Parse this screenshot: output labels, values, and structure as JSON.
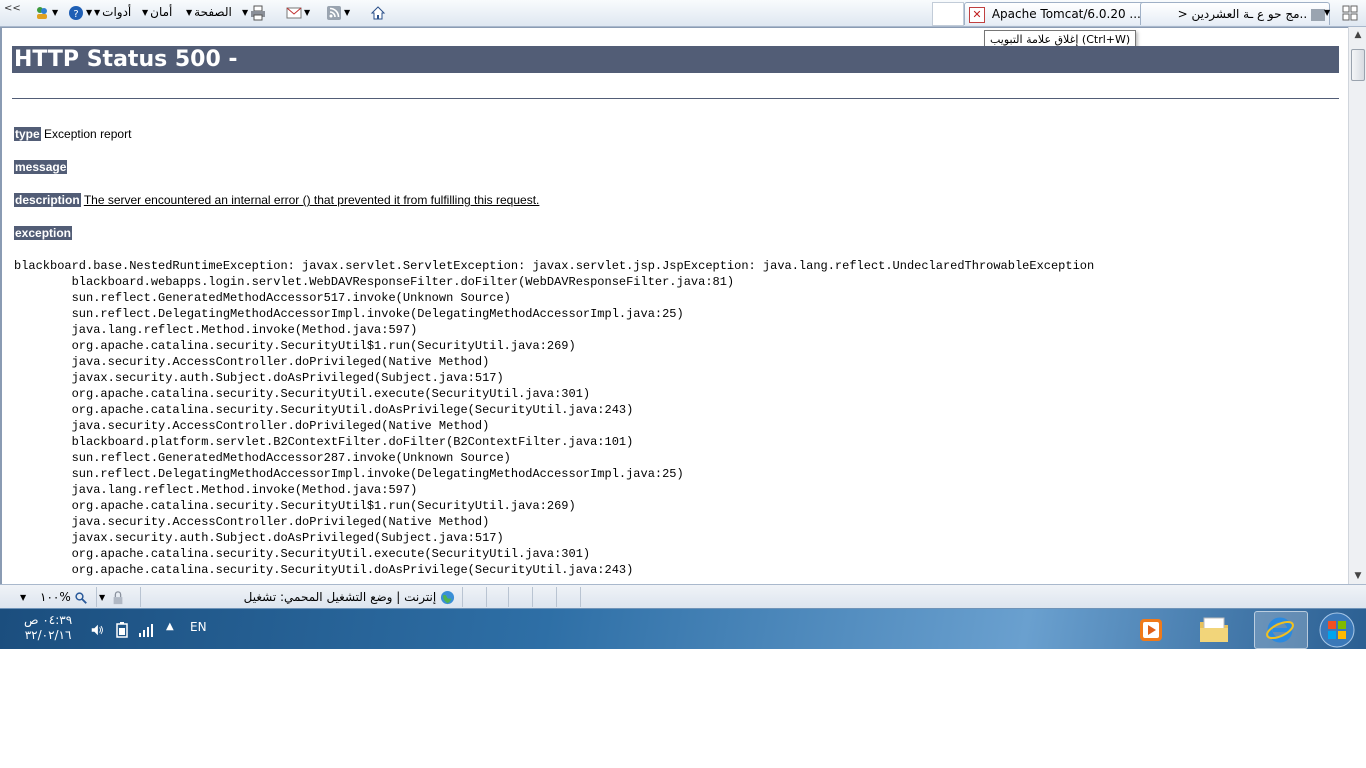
{
  "toolbar": {
    "tools_label": "أدوات",
    "safety_label": "أمان",
    "page_label": "الصفحة",
    "overflow_chevron": "<<"
  },
  "tabs": [
    {
      "title": "Apache Tomcat/6.0.20 ...",
      "close_glyph": "✕"
    },
    {
      "title": "..ﻣﺞ ﺣﻮ ع ـﺔ اﻟﻌﺸﺮدﻳﻦ <"
    }
  ],
  "tooltip": "إغلاق علامة التبويب (Ctrl+W)",
  "page": {
    "heading": "HTTP Status 500 -",
    "type_label": "type",
    "type_value": "Exception report",
    "message_label": "message",
    "description_label": "description",
    "description_value": "The server encountered an internal error () that prevented it from fulfilling this request.",
    "exception_label": "exception",
    "stack_trace": "blackboard.base.NestedRuntimeException: javax.servlet.ServletException: javax.servlet.jsp.JspException: java.lang.reflect.UndeclaredThrowableException\n\tblackboard.webapps.login.servlet.WebDAVResponseFilter.doFilter(WebDAVResponseFilter.java:81)\n\tsun.reflect.GeneratedMethodAccessor517.invoke(Unknown Source)\n\tsun.reflect.DelegatingMethodAccessorImpl.invoke(DelegatingMethodAccessorImpl.java:25)\n\tjava.lang.reflect.Method.invoke(Method.java:597)\n\torg.apache.catalina.security.SecurityUtil$1.run(SecurityUtil.java:269)\n\tjava.security.AccessController.doPrivileged(Native Method)\n\tjavax.security.auth.Subject.doAsPrivileged(Subject.java:517)\n\torg.apache.catalina.security.SecurityUtil.execute(SecurityUtil.java:301)\n\torg.apache.catalina.security.SecurityUtil.doAsPrivilege(SecurityUtil.java:243)\n\tjava.security.AccessController.doPrivileged(Native Method)\n\tblackboard.platform.servlet.B2ContextFilter.doFilter(B2ContextFilter.java:101)\n\tsun.reflect.GeneratedMethodAccessor287.invoke(Unknown Source)\n\tsun.reflect.DelegatingMethodAccessorImpl.invoke(DelegatingMethodAccessorImpl.java:25)\n\tjava.lang.reflect.Method.invoke(Method.java:597)\n\torg.apache.catalina.security.SecurityUtil$1.run(SecurityUtil.java:269)\n\tjava.security.AccessController.doPrivileged(Native Method)\n\tjavax.security.auth.Subject.doAsPrivileged(Subject.java:517)\n\torg.apache.catalina.security.SecurityUtil.execute(SecurityUtil.java:301)\n\torg.apache.catalina.security.SecurityUtil.doAsPrivilege(SecurityUtil.java:243)"
  },
  "statusbar": {
    "zone_text": "إنترنت | وضع التشغيل المحمي: تشغيل",
    "zoom_text": "١٠٠%"
  },
  "taskbar": {
    "clock_time": "٠٤:٣٩ ص",
    "clock_date": "٣٢/٠٢/١٦",
    "language": "EN"
  },
  "colors": {
    "tomcat_header": "#525d76",
    "taskbar_base": "#2e6fa6"
  },
  "icons": [
    "home-icon",
    "rss-icon",
    "mail-icon",
    "print-icon",
    "help-icon",
    "messenger-icon",
    "close-tab-icon",
    "globe-icon",
    "zoom-icon",
    "security-icon",
    "volume-icon",
    "battery-icon",
    "signal-icon",
    "tray-expand-icon",
    "media-player-icon",
    "explorer-icon",
    "ie-icon",
    "windows-start-icon"
  ]
}
